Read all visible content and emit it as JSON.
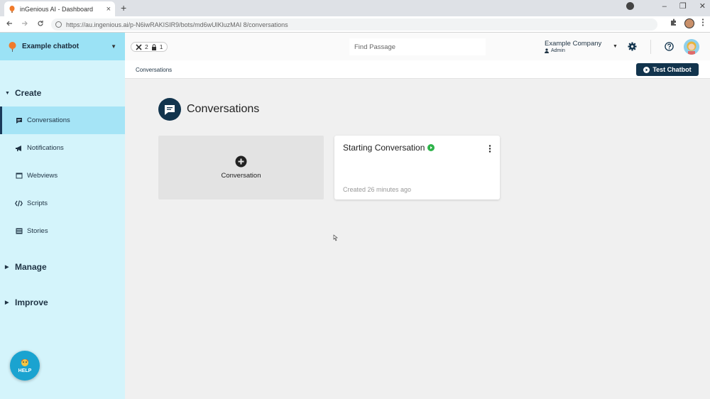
{
  "browser": {
    "tab_title": "inGenious AI - Dashboard",
    "tab_close": "×",
    "new_tab": "+",
    "url": "https://au.ingenious.ai/p-N6iwRAKISIR9/bots/md6wUlKluzMAI 8/conversations",
    "win_min": "–",
    "win_max": "❐",
    "win_close": "✕",
    "icons": [
      "back-icon",
      "forward-icon",
      "reload-icon",
      "extensions-icon",
      "kebab-menu-icon"
    ]
  },
  "sidebar": {
    "bot_name": "Example chatbot",
    "sections": {
      "create": "Create",
      "manage": "Manage",
      "improve": "Improve"
    },
    "items": [
      {
        "label": "Conversations",
        "icon": "chat-icon",
        "active": true
      },
      {
        "label": "Notifications",
        "icon": "megaphone-icon"
      },
      {
        "label": "Webviews",
        "icon": "window-icon"
      },
      {
        "label": "Scripts",
        "icon": "code-icon"
      },
      {
        "label": "Stories",
        "icon": "book-icon"
      }
    ],
    "help_label": "HELP"
  },
  "header": {
    "badge_a": "2",
    "badge_b": "1",
    "search_placeholder": "Find Passage",
    "company": "Example Company",
    "role": "Admin"
  },
  "subbar": {
    "breadcrumb": "Conversations",
    "test_button": "Test Chatbot"
  },
  "main": {
    "page_title": "Conversations",
    "new_card_label": "Conversation",
    "cards": [
      {
        "title": "Starting Conversation",
        "meta": "Created 26 minutes ago"
      }
    ]
  },
  "colors": {
    "sidebar_bg": "#d4f4fb",
    "sidebar_active": "#a5e4f6",
    "brand_dark": "#12344d",
    "live_green": "#2eb34a"
  }
}
